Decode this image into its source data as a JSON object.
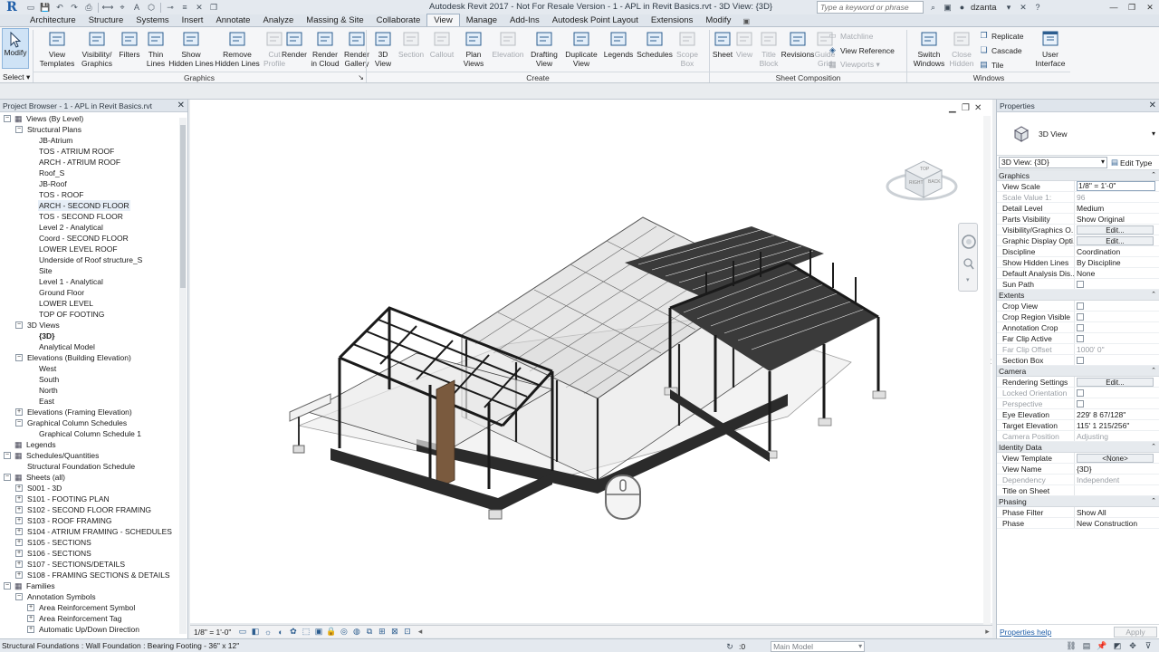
{
  "titlebar": {
    "app_logo": "R",
    "title": "Autodesk Revit 2017 -  Not For Resale Version  -   1 - APL in Revit Basics.rvt - 3D View: {3D}",
    "search_placeholder": "Type a keyword or phrase",
    "user": "dzanta",
    "qat_icons": [
      "open-icon",
      "save-icon",
      "undo-icon",
      "redo-icon",
      "print-icon",
      "measure-icon",
      "tag-icon",
      "text-icon",
      "3d-view-icon",
      "section-icon",
      "thin-lines-icon",
      "close-hidden-icon",
      "switch-windows-icon"
    ]
  },
  "tabs": [
    {
      "label": "Architecture"
    },
    {
      "label": "Structure"
    },
    {
      "label": "Systems"
    },
    {
      "label": "Insert"
    },
    {
      "label": "Annotate"
    },
    {
      "label": "Analyze"
    },
    {
      "label": "Massing & Site"
    },
    {
      "label": "Collaborate"
    },
    {
      "label": "View"
    },
    {
      "label": "Manage"
    },
    {
      "label": "Add-Ins"
    },
    {
      "label": "Autodesk Point Layout"
    },
    {
      "label": "Extensions"
    },
    {
      "label": "Modify"
    }
  ],
  "ribbon": {
    "modify": "Modify",
    "select": "Select ▾",
    "graphics_panel": "Graphics",
    "create_panel": "Create",
    "sheet_panel": "Sheet Composition",
    "windows_panel": "Windows",
    "graphics_buttons": [
      {
        "label": "View\nTemplates",
        "icon": "view-templates-icon"
      },
      {
        "label": "Visibility/\nGraphics",
        "icon": "visibility-graphics-icon"
      },
      {
        "label": "Filters",
        "icon": "filters-icon"
      },
      {
        "label": "Thin\nLines",
        "icon": "thin-lines-icon"
      },
      {
        "label": "Show\nHidden Lines",
        "icon": "show-hidden-lines-icon"
      },
      {
        "label": "Remove\nHidden Lines",
        "icon": "remove-hidden-lines-icon"
      },
      {
        "label": "Cut\nProfile",
        "icon": "cut-profile-icon",
        "disabled": true
      }
    ],
    "render_buttons": [
      {
        "label": "Render",
        "icon": "render-icon"
      },
      {
        "label": "Render\nin Cloud",
        "icon": "render-cloud-icon"
      },
      {
        "label": "Render\nGallery",
        "icon": "render-gallery-icon"
      }
    ],
    "create_buttons": [
      {
        "label": "3D\nView",
        "icon": "3d-view-icon"
      },
      {
        "label": "Section",
        "icon": "section-icon",
        "disabled": true
      },
      {
        "label": "Callout",
        "icon": "callout-icon",
        "disabled": true
      },
      {
        "label": "Plan\nViews",
        "icon": "plan-views-icon"
      },
      {
        "label": "Elevation",
        "icon": "elevation-icon",
        "disabled": true
      },
      {
        "label": "Drafting\nView",
        "icon": "drafting-view-icon"
      },
      {
        "label": "Duplicate\nView",
        "icon": "duplicate-view-icon"
      },
      {
        "label": "Legends",
        "icon": "legends-icon"
      },
      {
        "label": "Schedules",
        "icon": "schedules-icon"
      },
      {
        "label": "Scope\nBox",
        "icon": "scope-box-icon",
        "disabled": true
      }
    ],
    "sheet_buttons": [
      {
        "label": "Sheet",
        "icon": "sheet-icon"
      },
      {
        "label": "View",
        "icon": "view-icon",
        "disabled": true
      },
      {
        "label": "Title\nBlock",
        "icon": "title-block-icon",
        "disabled": true
      },
      {
        "label": "Revisions",
        "icon": "revisions-icon"
      },
      {
        "label": "Guide\nGrid",
        "icon": "guide-grid-icon",
        "disabled": true
      }
    ],
    "sheet_small": [
      {
        "label": "Matchline",
        "disabled": true
      },
      {
        "label": "View Reference",
        "disabled": false
      },
      {
        "label": "Viewports ▾",
        "disabled": true
      }
    ],
    "windows_buttons": [
      {
        "label": "Switch\nWindows",
        "icon": "switch-windows-icon"
      },
      {
        "label": "Close\nHidden",
        "icon": "close-hidden-icon",
        "disabled": true
      }
    ],
    "windows_small": [
      {
        "label": "Replicate"
      },
      {
        "label": "Cascade"
      },
      {
        "label": "Tile"
      }
    ],
    "user_interface": "User\nInterface"
  },
  "browser": {
    "title": "Project Browser - 1 - APL in Revit Basics.rvt",
    "nodes": [
      {
        "label": "Views (By Level)",
        "level": 0,
        "exp": "−"
      },
      {
        "label": "Structural Plans",
        "level": 1,
        "exp": "−"
      },
      {
        "label": "JB-Atrium",
        "level": 2
      },
      {
        "label": "TOS - ATRIUM ROOF",
        "level": 2
      },
      {
        "label": "ARCH - ATRIUM ROOF",
        "level": 2
      },
      {
        "label": "Roof_S",
        "level": 2
      },
      {
        "label": "JB-Roof",
        "level": 2
      },
      {
        "label": "TOS - ROOF",
        "level": 2
      },
      {
        "label": "ARCH - SECOND FLOOR",
        "level": 2,
        "selected": true
      },
      {
        "label": "TOS - SECOND FLOOR",
        "level": 2
      },
      {
        "label": "Level 2 - Analytical",
        "level": 2
      },
      {
        "label": "Coord - SECOND FLOOR",
        "level": 2
      },
      {
        "label": "LOWER LEVEL ROOF",
        "level": 2
      },
      {
        "label": "Underside of Roof structure_S",
        "level": 2
      },
      {
        "label": "Site",
        "level": 2
      },
      {
        "label": "Level 1 - Analytical",
        "level": 2
      },
      {
        "label": "Ground Floor",
        "level": 2
      },
      {
        "label": "LOWER LEVEL",
        "level": 2
      },
      {
        "label": "TOP OF FOOTING",
        "level": 2
      },
      {
        "label": "3D Views",
        "level": 1,
        "exp": "−"
      },
      {
        "label": "{3D}",
        "level": 2,
        "bold": true
      },
      {
        "label": "Analytical Model",
        "level": 2
      },
      {
        "label": "Elevations (Building Elevation)",
        "level": 1,
        "exp": "−"
      },
      {
        "label": "West",
        "level": 2
      },
      {
        "label": "South",
        "level": 2
      },
      {
        "label": "North",
        "level": 2
      },
      {
        "label": "East",
        "level": 2
      },
      {
        "label": "Elevations (Framing Elevation)",
        "level": 1,
        "exp": "+"
      },
      {
        "label": "Graphical Column Schedules",
        "level": 1,
        "exp": "−"
      },
      {
        "label": "Graphical Column Schedule 1",
        "level": 2
      },
      {
        "label": "Legends",
        "level": 0,
        "exp": "",
        "icon": true
      },
      {
        "label": "Schedules/Quantities",
        "level": 0,
        "exp": "−",
        "icon": true
      },
      {
        "label": "Structural Foundation Schedule",
        "level": 1
      },
      {
        "label": "Sheets (all)",
        "level": 0,
        "exp": "−",
        "icon": true
      },
      {
        "label": "S001 - 3D",
        "level": 1,
        "exp": "+"
      },
      {
        "label": "S101 - FOOTING PLAN",
        "level": 1,
        "exp": "+"
      },
      {
        "label": "S102 - SECOND FLOOR FRAMING",
        "level": 1,
        "exp": "+"
      },
      {
        "label": "S103 - ROOF FRAMING",
        "level": 1,
        "exp": "+"
      },
      {
        "label": "S104 - ATRIUM FRAMING - SCHEDULES",
        "level": 1,
        "exp": "+"
      },
      {
        "label": "S105 - SECTIONS",
        "level": 1,
        "exp": "+"
      },
      {
        "label": "S106 - SECTIONS",
        "level": 1,
        "exp": "+"
      },
      {
        "label": "S107 - SECTIONS/DETAILS",
        "level": 1,
        "exp": "+"
      },
      {
        "label": "S108 - FRAMING SECTIONS & DETAILS",
        "level": 1,
        "exp": "+"
      },
      {
        "label": "Families",
        "level": 0,
        "exp": "−",
        "icon": true
      },
      {
        "label": "Annotation Symbols",
        "level": 1,
        "exp": "−"
      },
      {
        "label": "Area Reinforcement Symbol",
        "level": 2,
        "exp": "+"
      },
      {
        "label": "Area Reinforcement Tag",
        "level": 2,
        "exp": "+"
      },
      {
        "label": "Automatic Up/Down Direction",
        "level": 2,
        "exp": "+"
      }
    ]
  },
  "view_status": {
    "scale": "1/8\" = 1'-0\""
  },
  "properties": {
    "title": "Properties",
    "type_name": "3D View",
    "instance": "3D View: {3D}",
    "edit_type": "Edit Type",
    "groups": [
      {
        "name": "Graphics",
        "rows": [
          {
            "n": "View Scale",
            "v": "1/8\" = 1'-0\"",
            "kind": "input"
          },
          {
            "n": "Scale Value    1:",
            "v": "96",
            "dim": true
          },
          {
            "n": "Detail Level",
            "v": "Medium"
          },
          {
            "n": "Parts Visibility",
            "v": "Show Original"
          },
          {
            "n": "Visibility/Graphics O...",
            "v": "Edit...",
            "kind": "btn"
          },
          {
            "n": "Graphic Display Opti...",
            "v": "Edit...",
            "kind": "btn"
          },
          {
            "n": "Discipline",
            "v": "Coordination"
          },
          {
            "n": "Show Hidden Lines",
            "v": "By Discipline"
          },
          {
            "n": "Default Analysis Dis...",
            "v": "None"
          },
          {
            "n": "Sun Path",
            "v": "",
            "kind": "chk"
          }
        ]
      },
      {
        "name": "Extents",
        "rows": [
          {
            "n": "Crop View",
            "v": "",
            "kind": "chk"
          },
          {
            "n": "Crop Region Visible",
            "v": "",
            "kind": "chk"
          },
          {
            "n": "Annotation Crop",
            "v": "",
            "kind": "chk"
          },
          {
            "n": "Far Clip Active",
            "v": "",
            "kind": "chk"
          },
          {
            "n": "Far Clip Offset",
            "v": "1000'  0\"",
            "dim": true
          },
          {
            "n": "Section Box",
            "v": "",
            "kind": "chk"
          }
        ]
      },
      {
        "name": "Camera",
        "rows": [
          {
            "n": "Rendering Settings",
            "v": "Edit...",
            "kind": "btn"
          },
          {
            "n": "Locked Orientation",
            "v": "",
            "kind": "chk",
            "dim": true
          },
          {
            "n": "Perspective",
            "v": "",
            "kind": "chk",
            "dim": true
          },
          {
            "n": "Eye Elevation",
            "v": "229'  8 67/128\""
          },
          {
            "n": "Target Elevation",
            "v": "115'  1 215/256\""
          },
          {
            "n": "Camera Position",
            "v": "Adjusting",
            "dim": true
          }
        ]
      },
      {
        "name": "Identity Data",
        "rows": [
          {
            "n": "View Template",
            "v": "<None>",
            "kind": "btn"
          },
          {
            "n": "View Name",
            "v": "{3D}"
          },
          {
            "n": "Dependency",
            "v": "Independent",
            "dim": true
          },
          {
            "n": "Title on Sheet",
            "v": ""
          }
        ]
      },
      {
        "name": "Phasing",
        "rows": [
          {
            "n": "Phase Filter",
            "v": "Show All"
          },
          {
            "n": "Phase",
            "v": "New Construction"
          }
        ]
      }
    ],
    "help": "Properties help",
    "apply": "Apply"
  },
  "statusbar": {
    "message": "Structural Foundations : Wall Foundation : Bearing Footing - 36\" x 12\"",
    "filter_count": ":0",
    "workset": "Main Model"
  },
  "viewcube": {
    "top": "TOP",
    "front": "RIGHT",
    "back": "BACK"
  }
}
